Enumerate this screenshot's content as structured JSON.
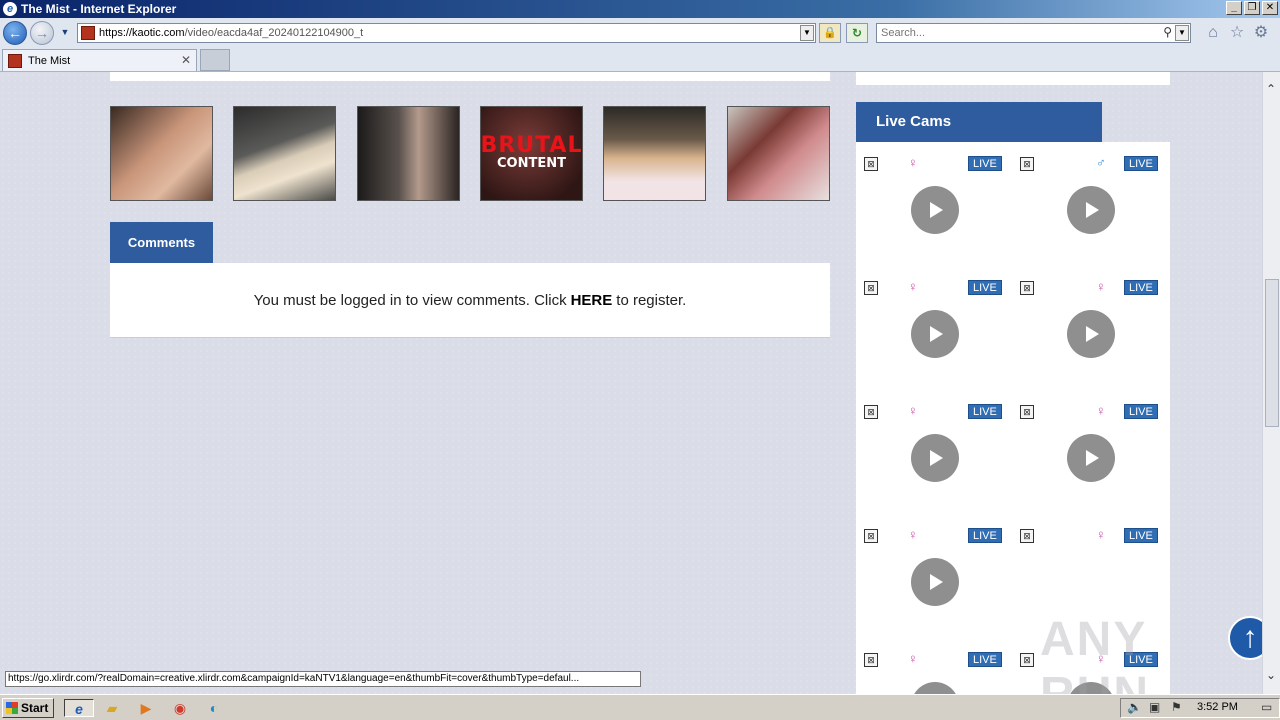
{
  "window": {
    "title": "The Mist - Internet Explorer"
  },
  "address": {
    "host": "https://kaotic.com",
    "path": "/video/eacda4af_20240122104900_t"
  },
  "search": {
    "placeholder": "Search..."
  },
  "tab": {
    "title": "The Mist"
  },
  "thumbnail_overlay": {
    "line1": "BRUTAL",
    "line2": "CONTENT"
  },
  "comments": {
    "tab_label": "Comments",
    "message_prefix": "You must be logged in to view comments. Click",
    "link_text": "HERE",
    "message_suffix": "to register."
  },
  "livecams": {
    "header": "Live Cams",
    "badge": "LIVE",
    "cams": [
      {
        "gender": "♀",
        "kind": "female"
      },
      {
        "gender": "♂",
        "kind": "male"
      },
      {
        "gender": "♀",
        "kind": "female"
      },
      {
        "gender": "♀",
        "kind": "female"
      },
      {
        "gender": "♀",
        "kind": "female"
      },
      {
        "gender": "♀",
        "kind": "female"
      },
      {
        "gender": "♀",
        "kind": "female"
      },
      {
        "gender": "♀",
        "kind": "female"
      },
      {
        "gender": "♀",
        "kind": "female"
      },
      {
        "gender": "♀",
        "kind": "female"
      }
    ]
  },
  "watermark": "ANY RUN",
  "status_url": "https://go.xlirdr.com/?realDomain=creative.xlirdr.com&campaignId=kaNTV1&language=en&thumbFit=cover&thumbType=defaul...",
  "taskbar": {
    "start_label": "Start",
    "clock": "3:52 PM"
  },
  "colors": {
    "accent": "#2e5c9e",
    "live_badge": "#2f6db5",
    "female": "#d04aa8",
    "male": "#3a8ad8"
  }
}
